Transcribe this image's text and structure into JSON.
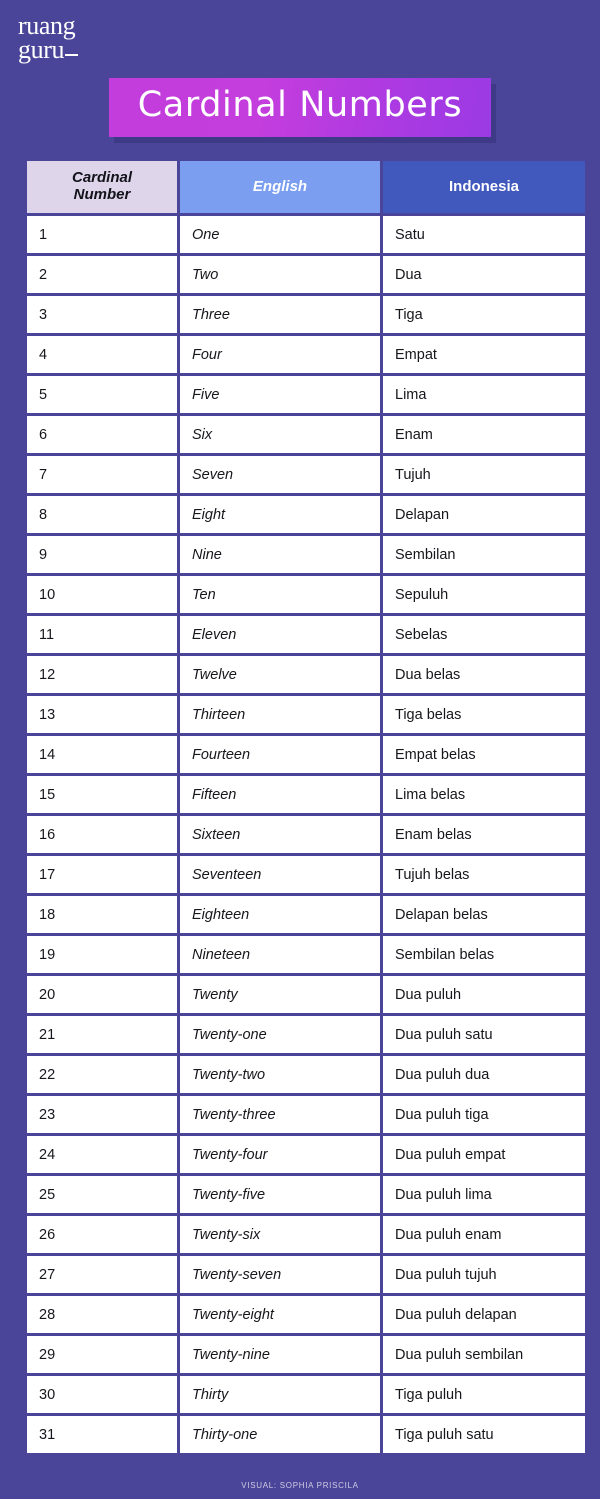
{
  "theme": {
    "background": "#4a4599",
    "banner_gradient_from": "#c23ddc",
    "banner_gradient_to": "#9b3ae4",
    "header_num_bg": "#ded5ea",
    "header_en_bg": "#7b9ef0",
    "header_id_bg": "#4158bd",
    "cell_bg": "#ffffff",
    "text_dark": "#16161c",
    "text_light": "#ffffff"
  },
  "logo": {
    "line1": "ruang",
    "line2": "guru"
  },
  "title": {
    "text": "Cardinal Numbers"
  },
  "table": {
    "headers": {
      "number": "Cardinal Number",
      "number_line1": "Cardinal",
      "number_line2": "Number",
      "english": "English",
      "indonesia": "Indonesia"
    },
    "rows": [
      {
        "number": "1",
        "english": "One",
        "indonesia": "Satu"
      },
      {
        "number": "2",
        "english": "Two",
        "indonesia": "Dua"
      },
      {
        "number": "3",
        "english": "Three",
        "indonesia": "Tiga"
      },
      {
        "number": "4",
        "english": "Four",
        "indonesia": "Empat"
      },
      {
        "number": "5",
        "english": "Five",
        "indonesia": "Lima"
      },
      {
        "number": "6",
        "english": "Six",
        "indonesia": "Enam"
      },
      {
        "number": "7",
        "english": "Seven",
        "indonesia": "Tujuh"
      },
      {
        "number": "8",
        "english": "Eight",
        "indonesia": "Delapan"
      },
      {
        "number": "9",
        "english": "Nine",
        "indonesia": "Sembilan"
      },
      {
        "number": "10",
        "english": "Ten",
        "indonesia": "Sepuluh"
      },
      {
        "number": "11",
        "english": "Eleven",
        "indonesia": "Sebelas"
      },
      {
        "number": "12",
        "english": "Twelve",
        "indonesia": "Dua belas"
      },
      {
        "number": "13",
        "english": "Thirteen",
        "indonesia": "Tiga belas"
      },
      {
        "number": "14",
        "english": "Fourteen",
        "indonesia": "Empat belas"
      },
      {
        "number": "15",
        "english": "Fifteen",
        "indonesia": "Lima belas"
      },
      {
        "number": "16",
        "english": "Sixteen",
        "indonesia": "Enam belas"
      },
      {
        "number": "17",
        "english": "Seventeen",
        "indonesia": "Tujuh belas"
      },
      {
        "number": "18",
        "english": "Eighteen",
        "indonesia": "Delapan belas"
      },
      {
        "number": "19",
        "english": "Nineteen",
        "indonesia": "Sembilan belas"
      },
      {
        "number": "20",
        "english": "Twenty",
        "indonesia": "Dua puluh"
      },
      {
        "number": "21",
        "english": "Twenty-one",
        "indonesia": "Dua puluh satu"
      },
      {
        "number": "22",
        "english": "Twenty-two",
        "indonesia": "Dua puluh dua"
      },
      {
        "number": "23",
        "english": "Twenty-three",
        "indonesia": "Dua puluh tiga"
      },
      {
        "number": "24",
        "english": "Twenty-four",
        "indonesia": "Dua puluh empat"
      },
      {
        "number": "25",
        "english": "Twenty-five",
        "indonesia": "Dua puluh lima"
      },
      {
        "number": "26",
        "english": "Twenty-six",
        "indonesia": "Dua puluh enam"
      },
      {
        "number": "27",
        "english": "Twenty-seven",
        "indonesia": "Dua puluh tujuh"
      },
      {
        "number": "28",
        "english": "Twenty-eight",
        "indonesia": "Dua puluh delapan"
      },
      {
        "number": "29",
        "english": "Twenty-nine",
        "indonesia": "Dua puluh sembilan"
      },
      {
        "number": "30",
        "english": "Thirty",
        "indonesia": "Tiga puluh"
      },
      {
        "number": "31",
        "english": "Thirty-one",
        "indonesia": "Tiga puluh satu"
      }
    ]
  },
  "footer": {
    "credit": "VISUAL: SOPHIA PRISCILA"
  }
}
